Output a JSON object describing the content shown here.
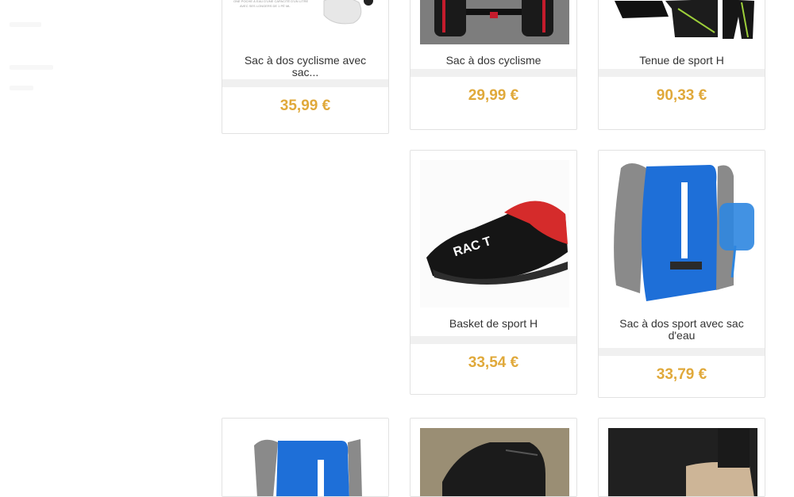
{
  "products": [
    {
      "name": "Sac à dos cyclisme avec sac...",
      "price": "35,99 €",
      "image": "hydration-backpack-accessory"
    },
    {
      "name": "Sac à dos cyclisme",
      "price": "29,99 €",
      "image": "cycling-backpack"
    },
    {
      "name": "Tenue de sport H",
      "price": "90,33 €",
      "image": "sport-outfit"
    },
    {
      "name": "Basket de sport H",
      "price": "33,54 €",
      "image": "sneaker"
    },
    {
      "name": "Sac à dos sport avec sac d'eau",
      "price": "33,79 €",
      "image": "blue-hydration-backpack"
    },
    {
      "name": "",
      "price": "",
      "image": "blue-hydration-backpack"
    },
    {
      "name": "",
      "price": "",
      "image": "black-sock-shoe"
    },
    {
      "name": "",
      "price": "",
      "image": "beige-shoe"
    }
  ],
  "colors": {
    "price": "#e0a93b",
    "border": "#e2e2e2",
    "divider": "#f0f0f0"
  }
}
